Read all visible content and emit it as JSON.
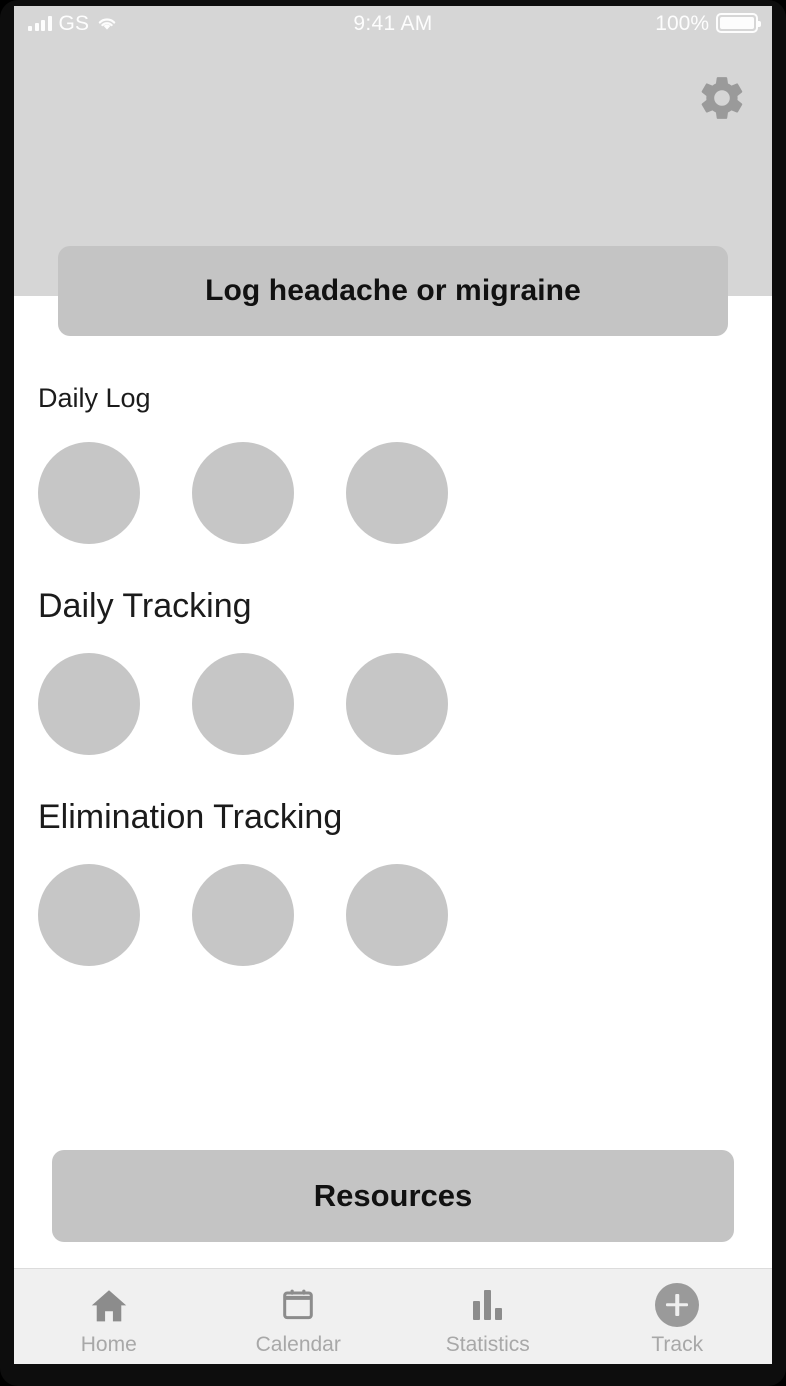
{
  "status_bar": {
    "carrier": "GS",
    "time": "9:41 AM",
    "battery_percent": "100%",
    "signal_icon": "signal-bars-icon",
    "wifi_icon": "wifi-icon",
    "battery_icon": "battery-full-icon"
  },
  "header": {
    "settings_icon": "gear-icon"
  },
  "main": {
    "cta_label": "Log headache or migraine",
    "resources_label": "Resources",
    "sections": [
      {
        "title": "Daily Log",
        "size": "sm",
        "circle_count": 3
      },
      {
        "title": "Daily Tracking",
        "size": "lg",
        "circle_count": 3
      },
      {
        "title": "Elimination Tracking",
        "size": "lg",
        "circle_count": 3
      }
    ]
  },
  "tabbar": {
    "items": [
      {
        "label": "Home",
        "icon": "home-icon"
      },
      {
        "label": "Calendar",
        "icon": "calendar-icon"
      },
      {
        "label": "Statistics",
        "icon": "bar-chart-icon"
      },
      {
        "label": "Track",
        "icon": "plus-circle-icon"
      }
    ]
  },
  "colors": {
    "header_bg": "#d6d6d6",
    "button_bg": "#c4c4c4",
    "placeholder": "#c6c6c6",
    "tabbar_bg": "#f0f0f0",
    "tab_label": "#a8a8a8",
    "icon_gray": "#8c8c8c"
  }
}
